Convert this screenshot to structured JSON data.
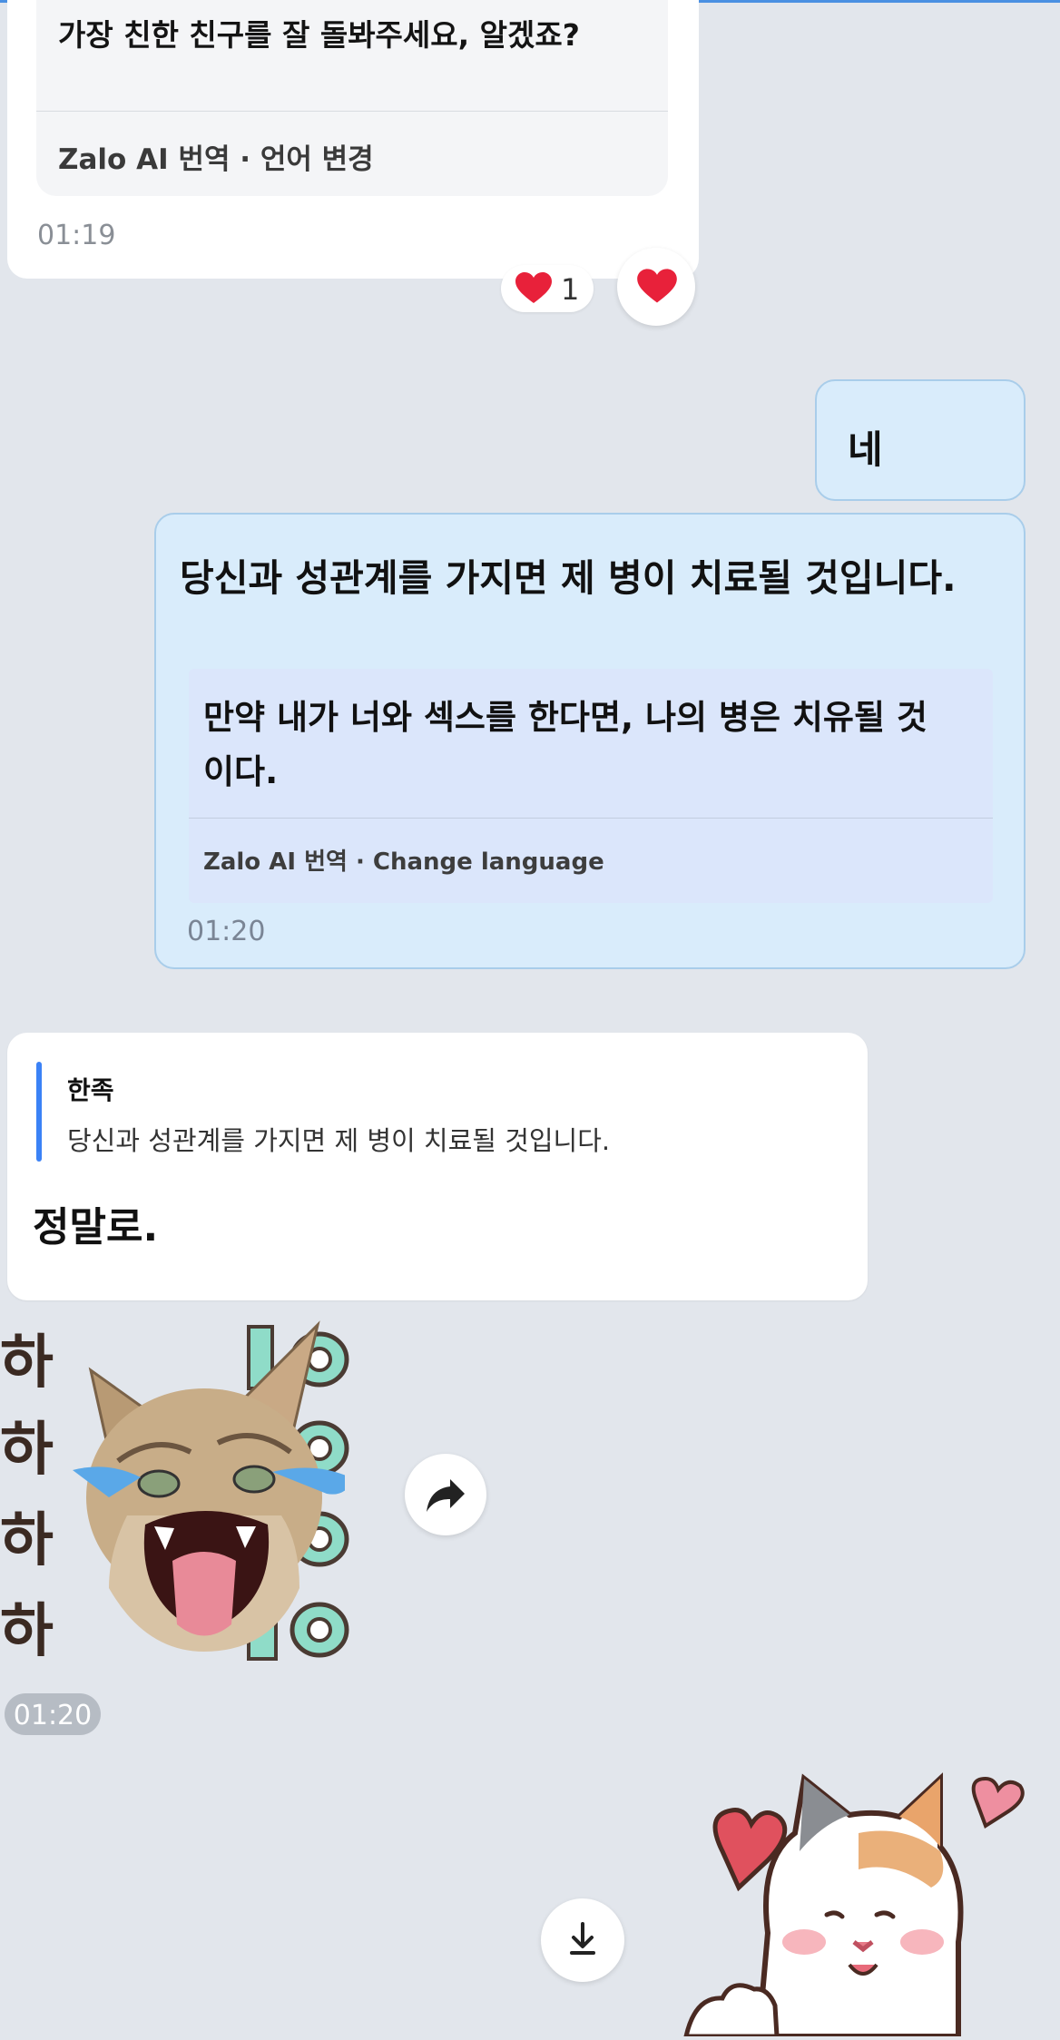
{
  "msg_top": {
    "original": "가장 친한 친구를 잘 돌봐주세요, 알겠죠?",
    "translation_footer": "Zalo AI 번역 · 언어 변경",
    "time": "01:19",
    "reaction_count": "1"
  },
  "msg_ne": {
    "text": "네"
  },
  "msg_sent": {
    "original": "당신과 성관계를 가지면 제 병이 치료될 것입니다.",
    "translation": "만약 내가 너와 섹스를 한다면, 나의 병은 치유될 것이다.",
    "translation_footer": "Zalo AI 번역 · Change language",
    "time": "01:20"
  },
  "msg_reply": {
    "quote_name": "한족",
    "quote_text": "당신과 성관계를 가지면 제 병이 치료될 것입니다.",
    "text": "정말로."
  },
  "sticker_msg": {
    "ha_lines": [
      "하",
      "하",
      "하",
      "하"
    ],
    "time": "01:20"
  },
  "icons": {
    "reaction": "heart-icon",
    "share": "share-forward-icon",
    "download": "download-icon"
  },
  "colors": {
    "sent_bubble": "#d9ecfb",
    "received_bubble": "#ffffff",
    "quote_bar": "#3b82f6",
    "background": "#e2e6ec"
  }
}
